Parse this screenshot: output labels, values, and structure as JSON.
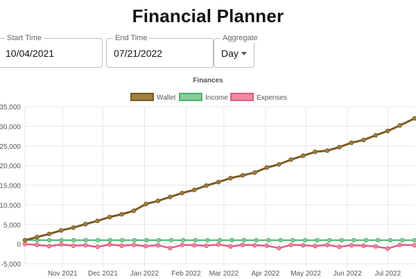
{
  "app": {
    "title": "Financial Planner"
  },
  "controls": {
    "start_time": {
      "label": "Start Time",
      "value": "10/04/2021"
    },
    "end_time": {
      "label": "End Time",
      "value": "07/21/2022"
    },
    "aggregate": {
      "label": "Aggregate",
      "value": "Day"
    }
  },
  "colors": {
    "wallet_fill": "#a0803f",
    "wallet_border": "#7a5a22",
    "income_fill": "#88cc9c",
    "income_border": "#4cb36c",
    "expenses_fill": "#f08aa2",
    "expenses_border": "#e05c7f",
    "grid": "#e6e6e6",
    "text": "#555555"
  },
  "chart_data": {
    "type": "line",
    "title": "Finances",
    "legend_position": "top-center",
    "grid": true,
    "ylim": [
      -5000,
      35000
    ],
    "yticks": [
      "35,000",
      "30,000",
      "25,000",
      "20,000",
      "15,000",
      "10,000",
      "5,000",
      "0",
      "-5,000"
    ],
    "xticks": [
      "Nov 2021",
      "Dec 2021",
      "Jan 2022",
      "Feb 2022",
      "Mar 2022",
      "Apr 2022",
      "May 2022",
      "Jun 2022",
      "Jul 2022"
    ],
    "xrange": [
      "2021-10-04",
      "2022-07-21"
    ],
    "series": [
      {
        "name": "Wallet",
        "x": [
          "2021-10-04",
          "2021-10-13",
          "2021-10-22",
          "2021-10-31",
          "2021-11-09",
          "2021-11-18",
          "2021-11-27",
          "2021-12-06",
          "2021-12-15",
          "2021-12-24",
          "2022-01-02",
          "2022-01-11",
          "2022-01-20",
          "2022-01-29",
          "2022-02-07",
          "2022-02-16",
          "2022-02-25",
          "2022-03-06",
          "2022-03-15",
          "2022-03-24",
          "2022-04-02",
          "2022-04-11",
          "2022-04-20",
          "2022-04-29",
          "2022-05-08",
          "2022-05-17",
          "2022-05-26",
          "2022-06-04",
          "2022-06-13",
          "2022-06-22",
          "2022-07-01",
          "2022-07-10",
          "2022-07-21"
        ],
        "values": [
          1000,
          1800,
          2600,
          3500,
          4200,
          5100,
          5900,
          6900,
          7600,
          8500,
          10200,
          11000,
          12000,
          13000,
          13800,
          14900,
          15800,
          16800,
          17500,
          18200,
          19500,
          20300,
          21500,
          22500,
          23500,
          23800,
          24700,
          25800,
          26500,
          27700,
          28800,
          30200,
          32000
        ]
      },
      {
        "name": "Income",
        "x": [
          "2021-10-04",
          "2022-07-21"
        ],
        "values": [
          1000,
          1000
        ]
      },
      {
        "name": "Expenses",
        "x": [
          "2021-10-04",
          "2021-10-13",
          "2021-10-22",
          "2021-10-31",
          "2021-11-09",
          "2021-11-18",
          "2021-11-27",
          "2021-12-06",
          "2021-12-15",
          "2021-12-24",
          "2022-01-02",
          "2022-01-11",
          "2022-01-20",
          "2022-01-29",
          "2022-02-07",
          "2022-02-16",
          "2022-02-25",
          "2022-03-06",
          "2022-03-15",
          "2022-03-24",
          "2022-04-02",
          "2022-04-11",
          "2022-04-20",
          "2022-04-29",
          "2022-05-08",
          "2022-05-17",
          "2022-05-26",
          "2022-06-04",
          "2022-06-13",
          "2022-06-22",
          "2022-07-01",
          "2022-07-10",
          "2022-07-21"
        ],
        "values": [
          0,
          -200,
          -500,
          -100,
          -400,
          -300,
          -700,
          -100,
          -400,
          -200,
          -500,
          -300,
          -1000,
          -200,
          -300,
          -400,
          -100,
          -600,
          -200,
          -300,
          -400,
          -1000,
          -200,
          -300,
          -500,
          -200,
          -700,
          -300,
          -400,
          -600,
          -1100,
          -200,
          -300
        ]
      }
    ]
  }
}
